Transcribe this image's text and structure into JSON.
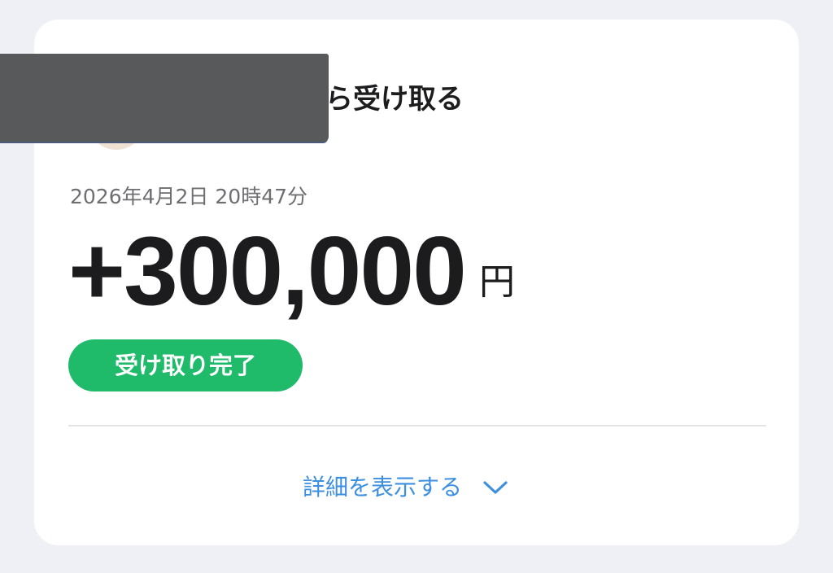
{
  "transaction": {
    "title": "ら受け取る",
    "datetime": "2026年4月2日 20時47分",
    "amount": "+300,000",
    "currency": "円",
    "status_badge": "受け取り完了",
    "status_color": "#1fba6a"
  },
  "details": {
    "label": "詳細を表示する",
    "icon": "chevron-down-icon",
    "color": "#3d8fe0"
  },
  "colors": {
    "background": "#eef0f5",
    "card": "#ffffff",
    "text_primary": "#1c1c1e",
    "text_secondary": "#6e6e73",
    "redaction": "#58595b"
  }
}
